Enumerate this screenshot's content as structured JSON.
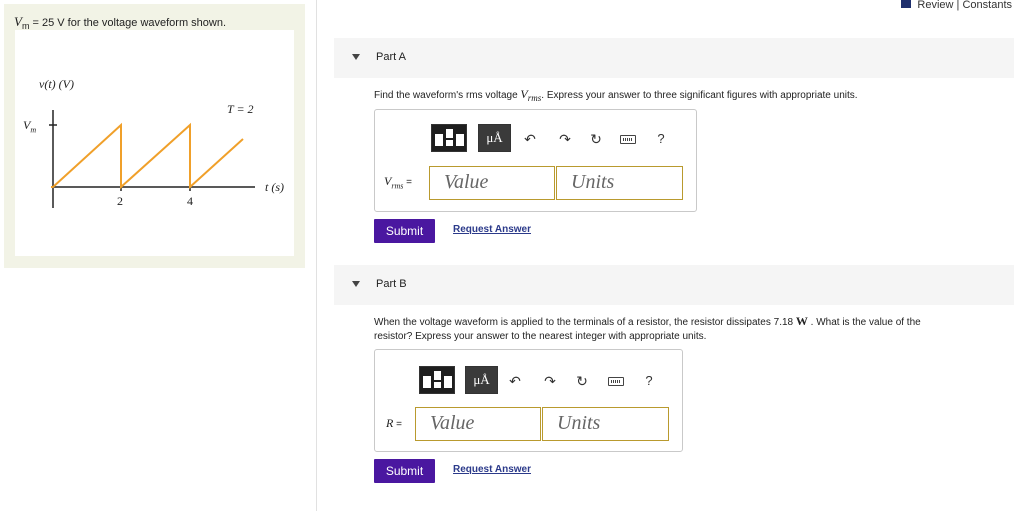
{
  "problem": {
    "statement_var": "V",
    "statement_sub": "m",
    "statement_text": " = 25 V for the voltage waveform shown."
  },
  "figure": {
    "y_axis_label": "v(t) (V)",
    "vm_label_main": "V",
    "vm_label_sub": "m",
    "period_label": "T = 2",
    "t_axis_label": "t (s)",
    "tick_labels": [
      "2",
      "4"
    ]
  },
  "top_links": {
    "review": "Review",
    "separator": "|",
    "constants": "Constants"
  },
  "partA": {
    "title": "Part A",
    "question_pre": "Find the waveform's rms voltage ",
    "question_var": "V",
    "question_sub": "rms",
    "question_post": ". Express your answer to three significant figures with appropriate units.",
    "var_label_main": "V",
    "var_label_sub": "rms",
    "var_label_eq": " =",
    "value_placeholder": "Value",
    "units_placeholder": "Units",
    "submit_label": "Submit",
    "request_label": "Request Answer"
  },
  "partB": {
    "title": "Part B",
    "question_line1_pre": "When the voltage waveform is applied to the terminals of a resistor, the resistor dissipates 7.18 ",
    "question_line1_unit": "W",
    "question_line1_post": " .  What is the value of the",
    "question_line2": "resistor? Express your answer to the nearest integer with appropriate units.",
    "var_label_main": "R",
    "var_label_eq": " =",
    "value_placeholder": "Value",
    "units_placeholder": "Units",
    "submit_label": "Submit",
    "request_label": "Request Answer"
  },
  "toolbar": {
    "mu_label": "μÅ",
    "help_label": "?"
  }
}
